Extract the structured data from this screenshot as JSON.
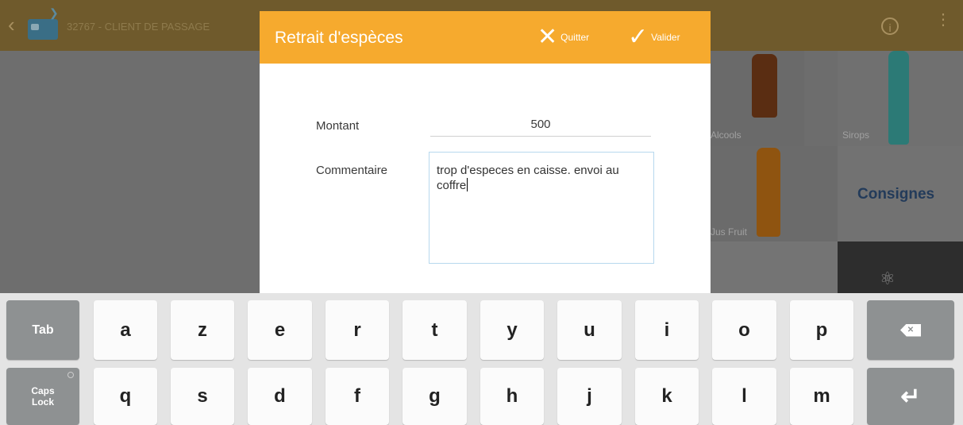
{
  "app": {
    "client_name": "32767 - CLIENT DE PASSAGE",
    "back_icon": "chevron-left-icon",
    "card_icon": "nfc-card-icon",
    "info_icon": "info-icon",
    "more_icon": "more-vert-icon"
  },
  "categories": {
    "alcools": "Alcools",
    "sirops": "Sirops",
    "jus_fruit": "Jus Fruit",
    "consignes": "Consignes"
  },
  "dialog": {
    "title": "Retrait d'espèces",
    "quit_label": "Quitter",
    "validate_label": "Valider",
    "amount_label": "Montant",
    "amount_value": "500",
    "comment_label": "Commentaire",
    "comment_value": "trop d'especes en caisse. envoi au coffre"
  },
  "keyboard": {
    "row1": [
      "Tab",
      "a",
      "z",
      "e",
      "r",
      "t",
      "y",
      "u",
      "i",
      "o",
      "p"
    ],
    "row2": [
      "Caps Lock",
      "q",
      "s",
      "d",
      "f",
      "g",
      "h",
      "j",
      "k",
      "l",
      "m"
    ],
    "backspace_icon": "backspace-icon",
    "enter_icon": "enter-icon"
  },
  "colors": {
    "accent": "#f6aa2e",
    "key_fn": "#8e9192",
    "consignes_text": "#233b5a"
  }
}
